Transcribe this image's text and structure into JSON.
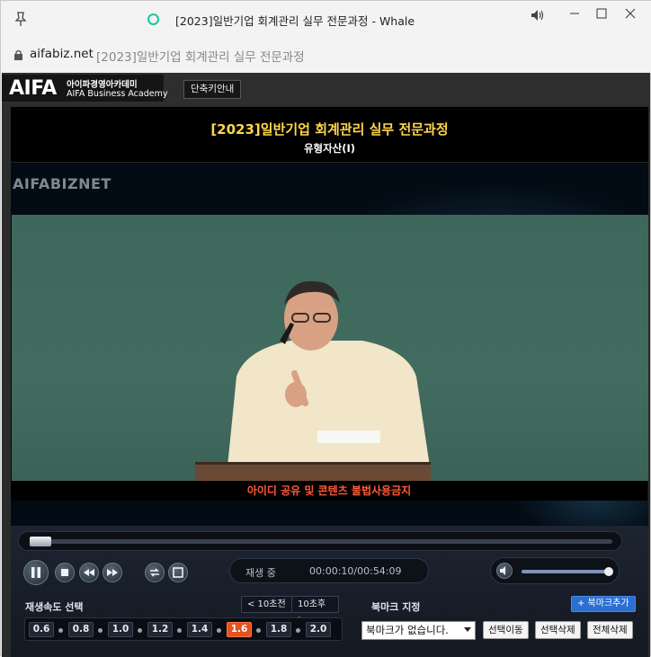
{
  "window": {
    "title": "[2023]일반기업 회계관리 실무 전문과정 - Whale",
    "controls": [
      "minimize",
      "maximize",
      "close"
    ]
  },
  "address_bar": {
    "host": "aifabiz.net",
    "page_title": "[2023]일반기업 회계관리 실무 전문과정"
  },
  "site": {
    "logo_main": "AIFA",
    "logo_kr": "아이파경영아카데미",
    "logo_en": "AIFA Business Academy",
    "shortcut_button": "단축키안내"
  },
  "lecture": {
    "title": "[2023]일반기업 회계관리 실무 전문과정",
    "subtitle": "유형자산(Ⅰ)",
    "watermark": "AIFABIZNET",
    "notice": "아이디 공유 및 콘텐츠 불법사용금지"
  },
  "player": {
    "status": "재생 중",
    "time": "00:00:10/00:54:09",
    "progress_fraction": 0.003,
    "volume_fraction": 1.0
  },
  "speed": {
    "label": "재생속도 선택",
    "back_button": "< 10초전",
    "forward_button": "10초후 >",
    "options": [
      "0.6",
      "0.8",
      "1.0",
      "1.2",
      "1.4",
      "1.6",
      "1.8",
      "2.0"
    ],
    "selected": "1.6"
  },
  "bookmark": {
    "label": "북마크 지정",
    "add_button": "+ 북마크추가",
    "select_value": "북마크가 없습니다.",
    "move_button": "선택이동",
    "delete_button": "선택삭제",
    "delete_all_button": "전체삭제"
  },
  "colors": {
    "title_yellow": "#ffd64a",
    "notice_red": "#ff5a3a",
    "speed_active": "#e0521e",
    "bookmark_add": "#2b6fd1",
    "chalkboard": "#3f6558"
  }
}
